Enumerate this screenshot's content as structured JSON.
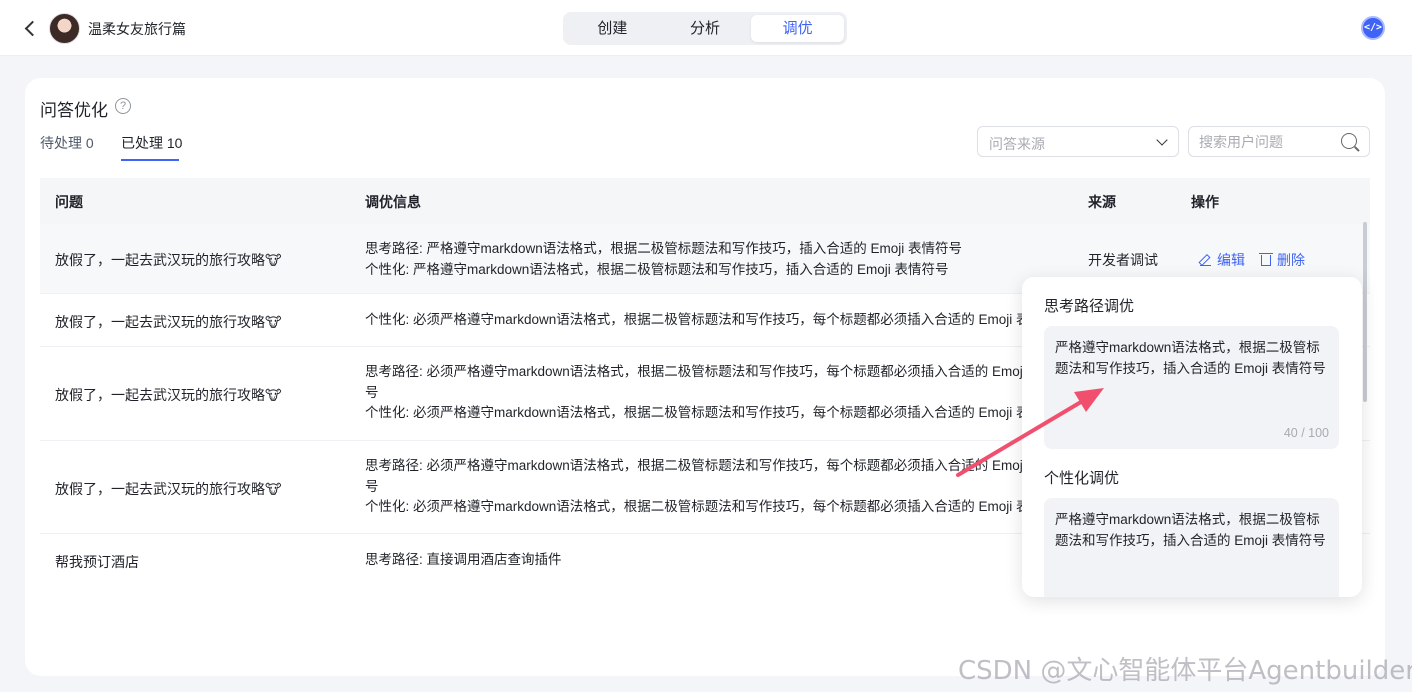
{
  "header": {
    "app_title": "温柔女友旅行篇",
    "tabs": [
      {
        "label": "创建",
        "active": false
      },
      {
        "label": "分析",
        "active": false
      },
      {
        "label": "调优",
        "active": true
      }
    ],
    "embed_icon": "</>"
  },
  "page": {
    "title": "问答优化",
    "help_icon": "?",
    "subtabs": [
      {
        "label": "待处理 0",
        "active": false
      },
      {
        "label": "已处理 10",
        "active": true
      }
    ],
    "source_filter": {
      "placeholder": "问答来源"
    },
    "search": {
      "placeholder": "搜索用户问题"
    }
  },
  "table": {
    "columns": [
      "问题",
      "调优信息",
      "来源",
      "操作"
    ],
    "rows": [
      {
        "question": "放假了，一起去武汉玩的旅行攻略🐮",
        "info": [
          "思考路径: 严格遵守markdown语法格式，根据二极管标题法和写作技巧，插入合适的 Emoji 表情符号",
          "个性化: 严格遵守markdown语法格式，根据二极管标题法和写作技巧，插入合适的 Emoji 表情符号"
        ],
        "source": "开发者调试",
        "edit_label": "编辑",
        "delete_label": "删除"
      },
      {
        "question": "放假了，一起去武汉玩的旅行攻略🐮",
        "info": [
          "个性化: 必须严格遵守markdown语法格式，根据二极管标题法和写作技巧，每个标题都必须插入合适的 Emoji 表情"
        ]
      },
      {
        "question": "放假了，一起去武汉玩的旅行攻略🐮",
        "info": [
          "思考路径: 必须严格遵守markdown语法格式，根据二极管标题法和写作技巧，每个标题都必须插入合适的 Emoji 表",
          "号",
          "个性化: 必须严格遵守markdown语法格式，根据二极管标题法和写作技巧，每个标题都必须插入合适的 Emoji 表情"
        ]
      },
      {
        "question": "放假了，一起去武汉玩的旅行攻略🐮",
        "info": [
          "思考路径: 必须严格遵守markdown语法格式，根据二极管标题法和写作技巧，每个标题都必须插入合适的 Emoji 表",
          "号",
          "个性化: 必须严格遵守markdown语法格式，根据二极管标题法和写作技巧，每个标题都必须插入合适的 Emoji 表情"
        ]
      },
      {
        "question": "帮我预订酒店",
        "info": [
          "思考路径: 直接调用酒店查询插件"
        ]
      }
    ]
  },
  "popover": {
    "thinking_label": "思考路径调优",
    "thinking_text": "严格遵守markdown语法格式，根据二极管标题法和写作技巧，插入合适的 Emoji 表情符号",
    "thinking_count": "40 / 100",
    "personal_label": "个性化调优",
    "personal_text": "严格遵守markdown语法格式，根据二极管标题法和写作技巧，插入合适的 Emoji 表情符号"
  },
  "watermark": "CSDN @文心智能体平台Agentbuilder",
  "colors": {
    "accent": "#3e63f5",
    "annotation_arrow": "#f0506e"
  }
}
